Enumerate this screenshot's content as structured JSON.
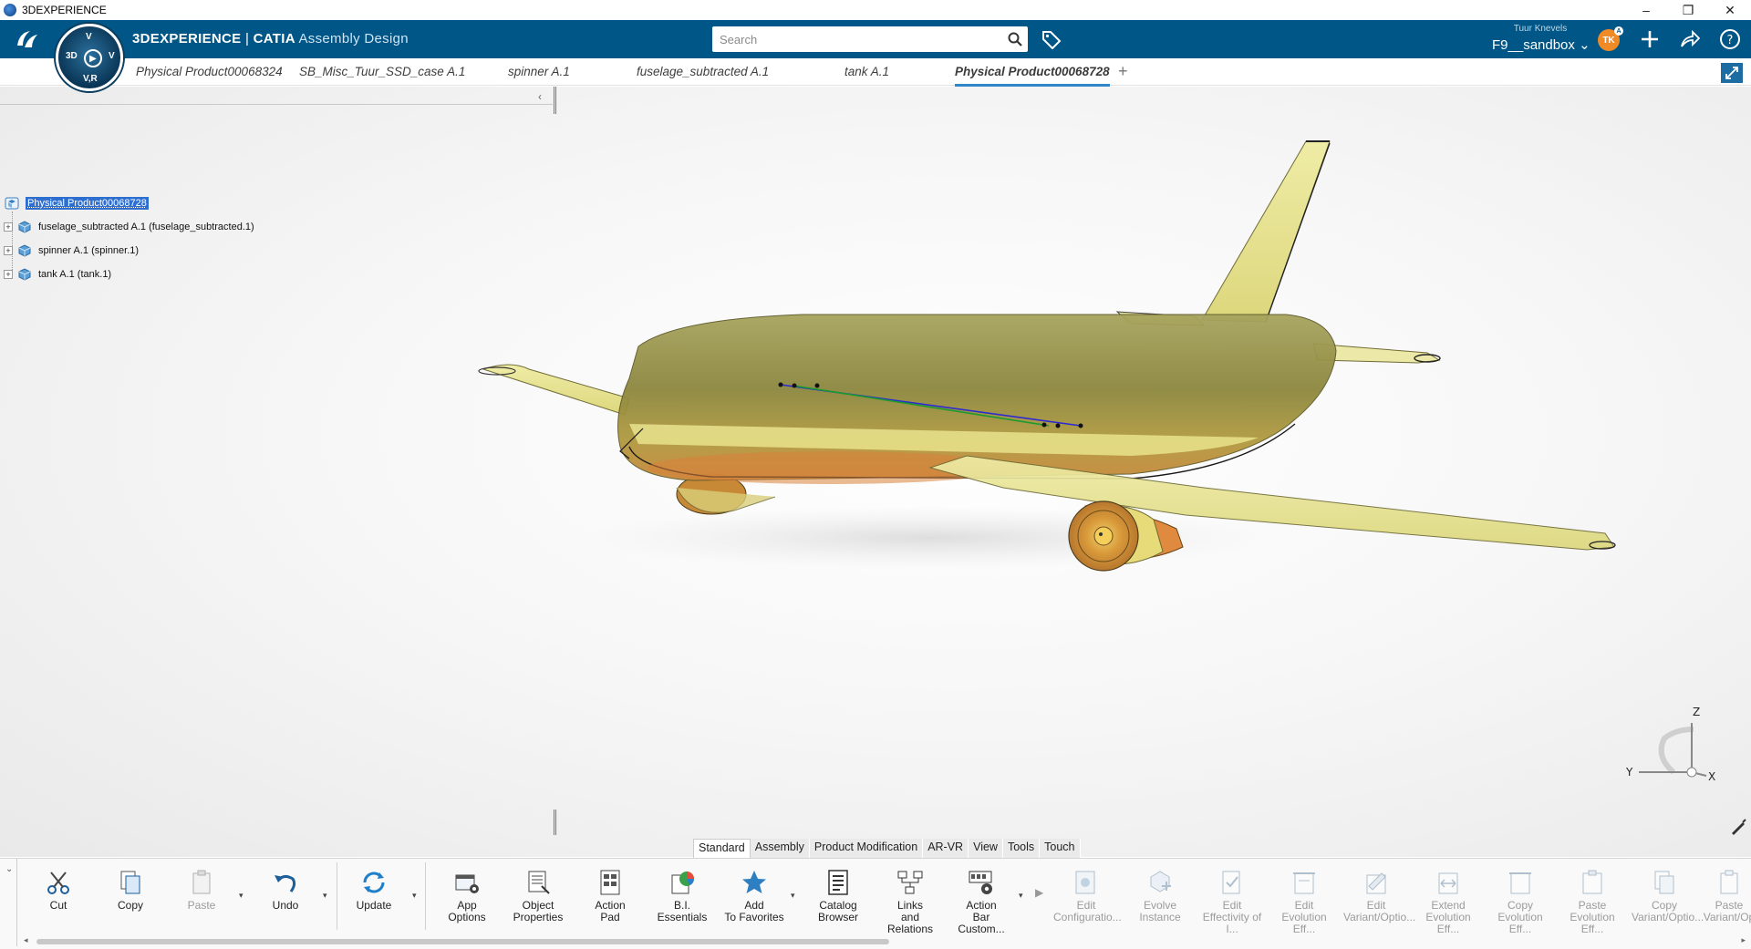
{
  "window": {
    "title": "3DEXPERIENCE",
    "controls": {
      "minimize": "–",
      "restore": "❐",
      "close": "✕"
    }
  },
  "topbar": {
    "brand_prefix": "3DEXPERIENCE",
    "brand_sep": " | ",
    "brand_app": "CATIA",
    "brand_workbench": " Assembly Design",
    "compass_labels": {
      "top": "V",
      "left": "3D",
      "right": "V",
      "bottom": "V,R",
      "center": "▶"
    },
    "search_placeholder": "Search",
    "user_name": "Tuur Knevels",
    "collab_space": "F9__sandbox",
    "avatar_initials": "TK",
    "avatar_badge": "A",
    "accent_color": "#005686"
  },
  "tabs": [
    {
      "label": "Physical Product00068324",
      "active": false
    },
    {
      "label": "SB_Misc_Tuur_SSD_case A.1",
      "active": false
    },
    {
      "label": "spinner A.1",
      "active": false
    },
    {
      "label": "fuselage_subtracted A.1",
      "active": false
    },
    {
      "label": "tank A.1",
      "active": false
    },
    {
      "label": "Physical Product00068728",
      "active": true
    }
  ],
  "tabs_add": "+",
  "tree": {
    "collapse_arrow": "‹",
    "root": "Physical Product00068728",
    "children": [
      {
        "label": "fuselage_subtracted A.1 (fuselage_subtracted.1)",
        "expander": "+"
      },
      {
        "label": "spinner A.1 (spinner.1)",
        "expander": "+"
      },
      {
        "label": "tank A.1 (tank.1)",
        "expander": "+"
      }
    ]
  },
  "compass_axes": {
    "z": "Z",
    "y": "Y",
    "x": "X"
  },
  "sections": [
    {
      "label": "Standard",
      "active": true
    },
    {
      "label": "Assembly",
      "active": false
    },
    {
      "label": "Product Modification",
      "active": false
    },
    {
      "label": "AR-VR",
      "active": false
    },
    {
      "label": "View",
      "active": false
    },
    {
      "label": "Tools",
      "active": false
    },
    {
      "label": "Touch",
      "active": false
    }
  ],
  "commands": {
    "cut": [
      "Cut",
      ""
    ],
    "copy": [
      "Copy",
      ""
    ],
    "paste": [
      "Paste",
      ""
    ],
    "undo": [
      "Undo",
      ""
    ],
    "update": [
      "Update",
      ""
    ],
    "app_options": [
      "App",
      "Options"
    ],
    "object_properties": [
      "Object",
      "Properties"
    ],
    "action_pad": [
      "Action",
      "Pad"
    ],
    "bi_essentials": [
      "B.I.",
      "Essentials"
    ],
    "add_favorites": [
      "Add",
      "To Favorites"
    ],
    "catalog_browser": [
      "Catalog",
      "Browser"
    ],
    "links_relations": [
      "Links",
      "and Relations"
    ],
    "action_bar_custom": [
      "Action",
      "Bar Custom..."
    ],
    "edit_configuration": [
      "Edit",
      "Configuratio..."
    ],
    "evolve_instance": [
      "Evolve",
      "Instance"
    ],
    "edit_effectivity": [
      "Edit",
      "Effectivity of I..."
    ],
    "edit_evolution": [
      "Edit",
      "Evolution Eff..."
    ],
    "edit_variant": [
      "Edit",
      "Variant/Optio..."
    ],
    "extend_evolution": [
      "Extend",
      "Evolution Eff..."
    ],
    "copy_evolution": [
      "Copy",
      "Evolution Eff..."
    ],
    "paste_evolution": [
      "Paste",
      "Evolution Eff..."
    ],
    "copy_variant": [
      "Copy",
      "Variant/Optio..."
    ],
    "paste_variant": [
      "Paste",
      "Variant/Op"
    ]
  }
}
